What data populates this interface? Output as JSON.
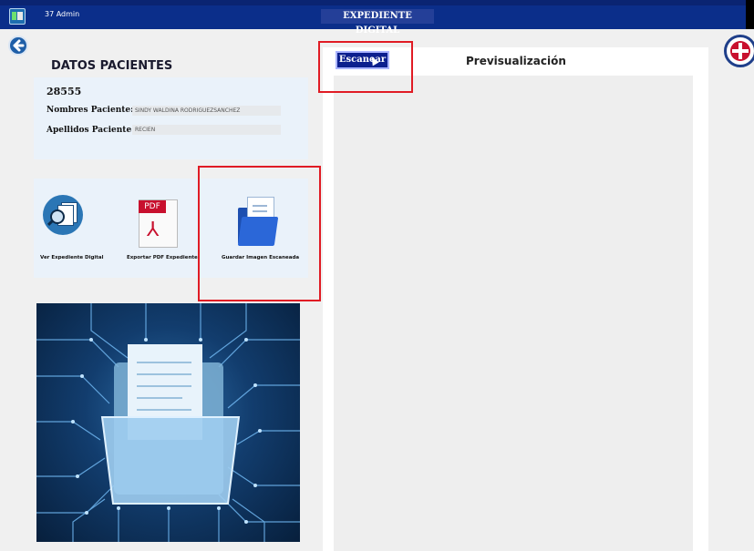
{
  "window": {
    "user": "37  Admin",
    "title": "EXPEDIENTE DIGITAL"
  },
  "patient": {
    "section_title": "DATOS PACIENTES",
    "id": "28555",
    "nombres_label": "Nombres Paciente:",
    "nombres_value": "SINDY WALDINA RODRIGUEZSANCHEZ",
    "apellidos_label": "Apellidos Paciente:",
    "apellidos_value": "RECIEN"
  },
  "actions": {
    "ver_label": "Ver Expediente Digital",
    "pdf_label": "Exportar PDF Expediente",
    "pdf_badge": "PDF",
    "save_label": "Guardar Imagen Escaneada"
  },
  "preview": {
    "scan_button": "Escanear",
    "title": "Previsualización"
  },
  "icons": {
    "back": "back-arrow-icon",
    "ver": "document-search-icon",
    "pdf": "pdf-file-icon",
    "save": "folder-document-icon",
    "seal": "medical-seal-logo"
  },
  "colors": {
    "title_bar": "#0b2e8a",
    "scan_button": "#0c1f8e",
    "highlight": "#e01b24",
    "panel": "#eaf2fa"
  }
}
